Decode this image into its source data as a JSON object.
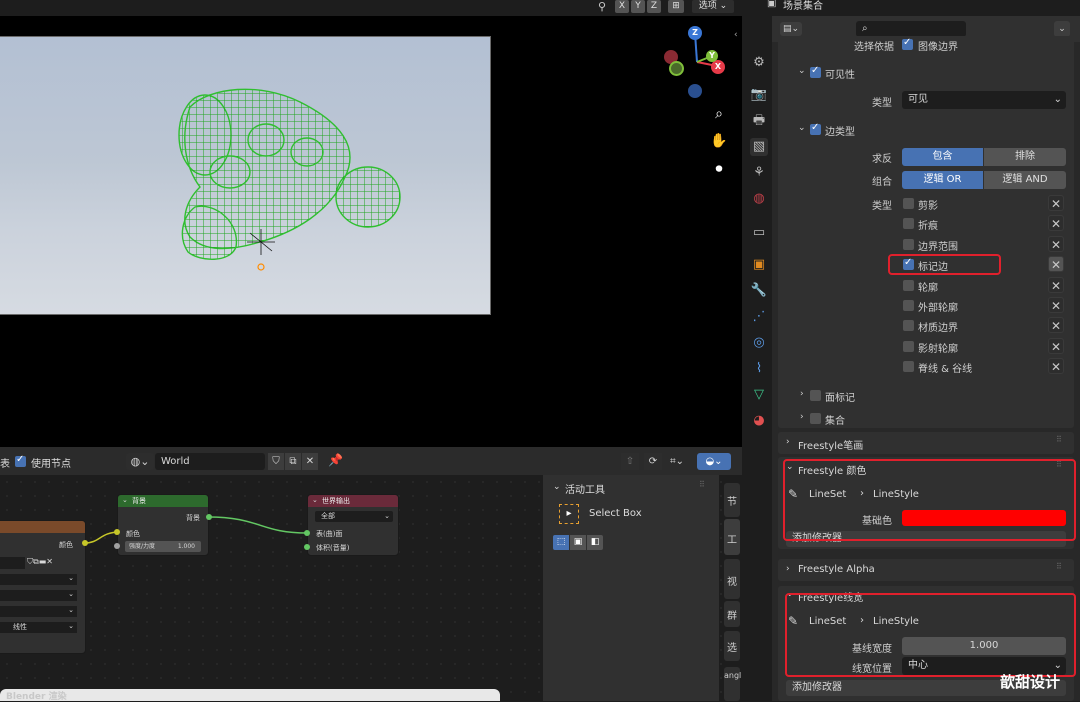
{
  "viewport": {
    "axis_x": "X",
    "axis_y": "Y",
    "axis_z": "Z",
    "options_label": "选项",
    "gizmo_x": "X",
    "gizmo_y": "Y",
    "gizmo_z": "Z"
  },
  "properties": {
    "top_label": "场景集合",
    "prev_row_label": "选择依据",
    "prev_row_value": "图像边界",
    "visibility_label": "可见性",
    "type_label": "类型",
    "type_value": "可见",
    "edge_types_label": "边类型",
    "negation_label": "求反",
    "negation_include": "包含",
    "negation_exclude": "排除",
    "combination_label": "组合",
    "combination_or": "逻辑 OR",
    "combination_and": "逻辑 AND",
    "edge_type_label": "类型",
    "edge_types": [
      {
        "label": "剪影",
        "checked": false
      },
      {
        "label": "折痕",
        "checked": false
      },
      {
        "label": "边界范围",
        "checked": false
      },
      {
        "label": "标记边",
        "checked": true
      },
      {
        "label": "轮廓",
        "checked": false
      },
      {
        "label": "外部轮廓",
        "checked": false
      },
      {
        "label": "材质边界",
        "checked": false
      },
      {
        "label": "影射轮廓",
        "checked": false
      },
      {
        "label": "脊线 & 谷线",
        "checked": false
      }
    ],
    "face_marks_label": "面标记",
    "collection_label": "集合",
    "freestyle_stroke": "Freestyle笔画",
    "freestyle_color": "Freestyle 颜色",
    "lineset": "LineSet",
    "linestyle": "LineStyle",
    "base_color_label": "基础色",
    "base_color": "#ff0000",
    "add_modifier": "添加修改器",
    "freestyle_alpha": "Freestyle Alpha",
    "freestyle_thickness": "Freestyle线宽",
    "base_thickness_label": "基线宽度",
    "base_thickness_value": "1.000",
    "thickness_position_label": "线宽位置",
    "thickness_position_value": "中心",
    "add_modifier_2": "添加修改器"
  },
  "node_editor": {
    "use_nodes_label": "使用节点",
    "world_name": "World",
    "background_node": {
      "title": "背景",
      "output": "背景",
      "color": "颜色",
      "strength_label": "强度/力度",
      "strength_value": "1.000"
    },
    "output_node": {
      "title": "世界输出",
      "target": "全部",
      "surface": "表(曲)面",
      "volume": "体积(音量)"
    },
    "left_node": {
      "dropdown": "线性"
    },
    "active_tool_label": "活动工具",
    "select_box_label": "Select Box",
    "side_tabs": [
      "节",
      "工",
      "视",
      "群",
      "选",
      "angl"
    ],
    "render_window_title": "Blender 渲染"
  },
  "colors": {
    "accent_blue": "#4772b3",
    "highlight_red": "#e0202c",
    "mesh_green": "#2fbf2f"
  },
  "watermark": "歆甜设计"
}
